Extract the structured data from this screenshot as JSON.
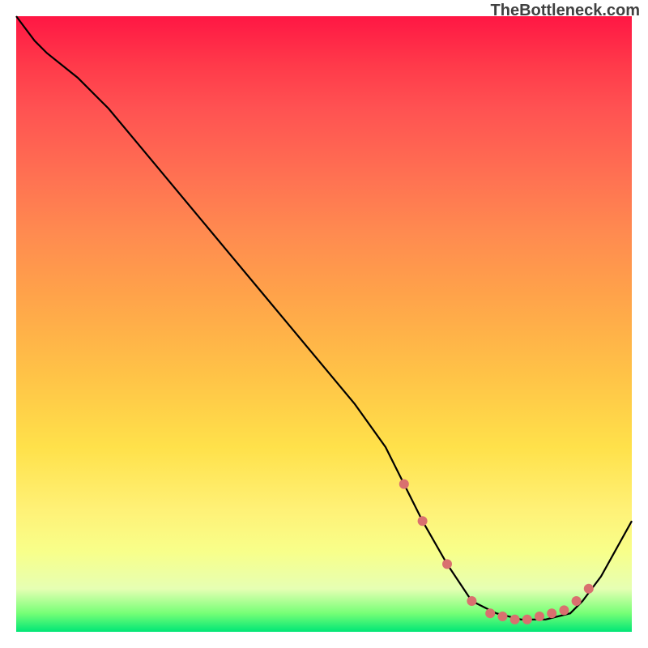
{
  "attribution": "TheBottleneck.com",
  "chart_data": {
    "type": "line",
    "title": "",
    "xlabel": "",
    "ylabel": "",
    "xlim": [
      0,
      100
    ],
    "ylim": [
      0,
      100
    ],
    "grid": false,
    "legend": false,
    "background": "rainbow-gradient-red-to-green",
    "series": [
      {
        "name": "bottleneck-curve",
        "color": "#000000",
        "x": [
          0,
          3,
          5,
          10,
          15,
          20,
          25,
          30,
          35,
          40,
          45,
          50,
          55,
          60,
          63,
          66,
          70,
          74,
          78,
          82,
          86,
          90,
          92,
          95,
          100
        ],
        "y": [
          100,
          96,
          94,
          90,
          85,
          79,
          73,
          67,
          61,
          55,
          49,
          43,
          37,
          30,
          24,
          18,
          11,
          5,
          3,
          2,
          2,
          3,
          5,
          9,
          18
        ]
      }
    ],
    "markers": {
      "name": "highlight-dots",
      "color": "#d9706f",
      "radius": 6,
      "points": [
        {
          "x": 63,
          "y": 24
        },
        {
          "x": 66,
          "y": 18
        },
        {
          "x": 70,
          "y": 11
        },
        {
          "x": 74,
          "y": 5
        },
        {
          "x": 77,
          "y": 3
        },
        {
          "x": 79,
          "y": 2.5
        },
        {
          "x": 81,
          "y": 2
        },
        {
          "x": 83,
          "y": 2
        },
        {
          "x": 85,
          "y": 2.5
        },
        {
          "x": 87,
          "y": 3
        },
        {
          "x": 89,
          "y": 3.5
        },
        {
          "x": 91,
          "y": 5
        },
        {
          "x": 93,
          "y": 7
        }
      ]
    }
  }
}
